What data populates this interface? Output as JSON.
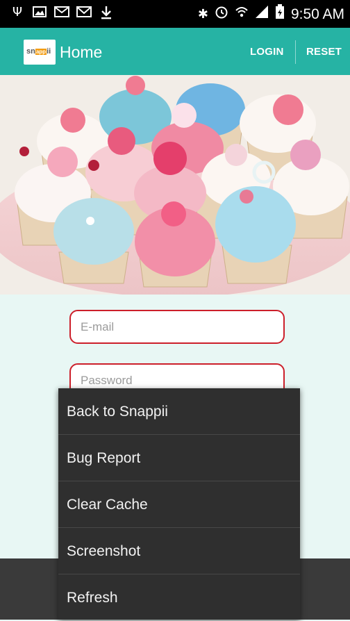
{
  "status_bar": {
    "time": "9:50 AM",
    "left_icons": [
      "usb-icon",
      "image-icon",
      "mms-icon",
      "gmail-icon",
      "download-icon"
    ],
    "right_icons": [
      "bluetooth-icon",
      "alarm-icon",
      "wifi-icon",
      "signal-icon",
      "battery-icon"
    ]
  },
  "action_bar": {
    "logo_text_a": "sn",
    "logo_text_b": "app",
    "logo_text_c": "ii",
    "title": "Home",
    "login_label": "LOGIN",
    "reset_label": "RESET"
  },
  "hero": {
    "image": "cupcakes-photo"
  },
  "form": {
    "email_placeholder": "E-mail",
    "password_placeholder": "Password"
  },
  "menu": {
    "items": [
      "Back to Snappii",
      "Bug Report",
      "Clear Cache",
      "Screenshot",
      "Refresh"
    ]
  },
  "colors": {
    "action_bar": "#26b3a4",
    "input_border": "#cc1f2a",
    "menu_bg": "#2f2f2f",
    "background": "#e8f7f4"
  }
}
